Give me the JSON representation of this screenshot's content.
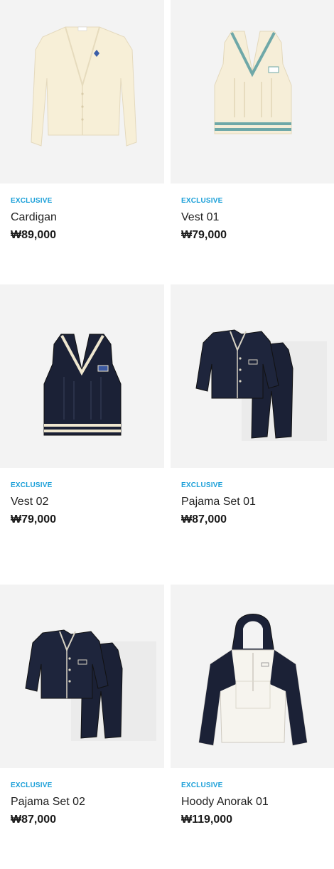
{
  "colors": {
    "badge": "#1a9fd8",
    "image_bg": "#f3f3f3",
    "navy": "#1b2136",
    "cream": "#f6eed8",
    "teal": "#6fa8a8"
  },
  "products": [
    {
      "badge": "EXCLUSIVE",
      "name": "Cardigan",
      "price": "₩89,000",
      "image_icon": "cardigan-image"
    },
    {
      "badge": "EXCLUSIVE",
      "name": "Vest 01",
      "price": "₩79,000",
      "image_icon": "vest-cream-image"
    },
    {
      "badge": "EXCLUSIVE",
      "name": "Vest 02",
      "price": "₩79,000",
      "image_icon": "vest-navy-image"
    },
    {
      "badge": "EXCLUSIVE",
      "name": "Pajama Set 01",
      "price": "₩87,000",
      "image_icon": "pajama-set-image"
    },
    {
      "badge": "EXCLUSIVE",
      "name": "Pajama Set 02",
      "price": "₩87,000",
      "image_icon": "pajama-set-image"
    },
    {
      "badge": "EXCLUSIVE",
      "name": "Hoody Anorak 01",
      "price": "₩119,000",
      "image_icon": "hoody-anorak-image"
    }
  ]
}
